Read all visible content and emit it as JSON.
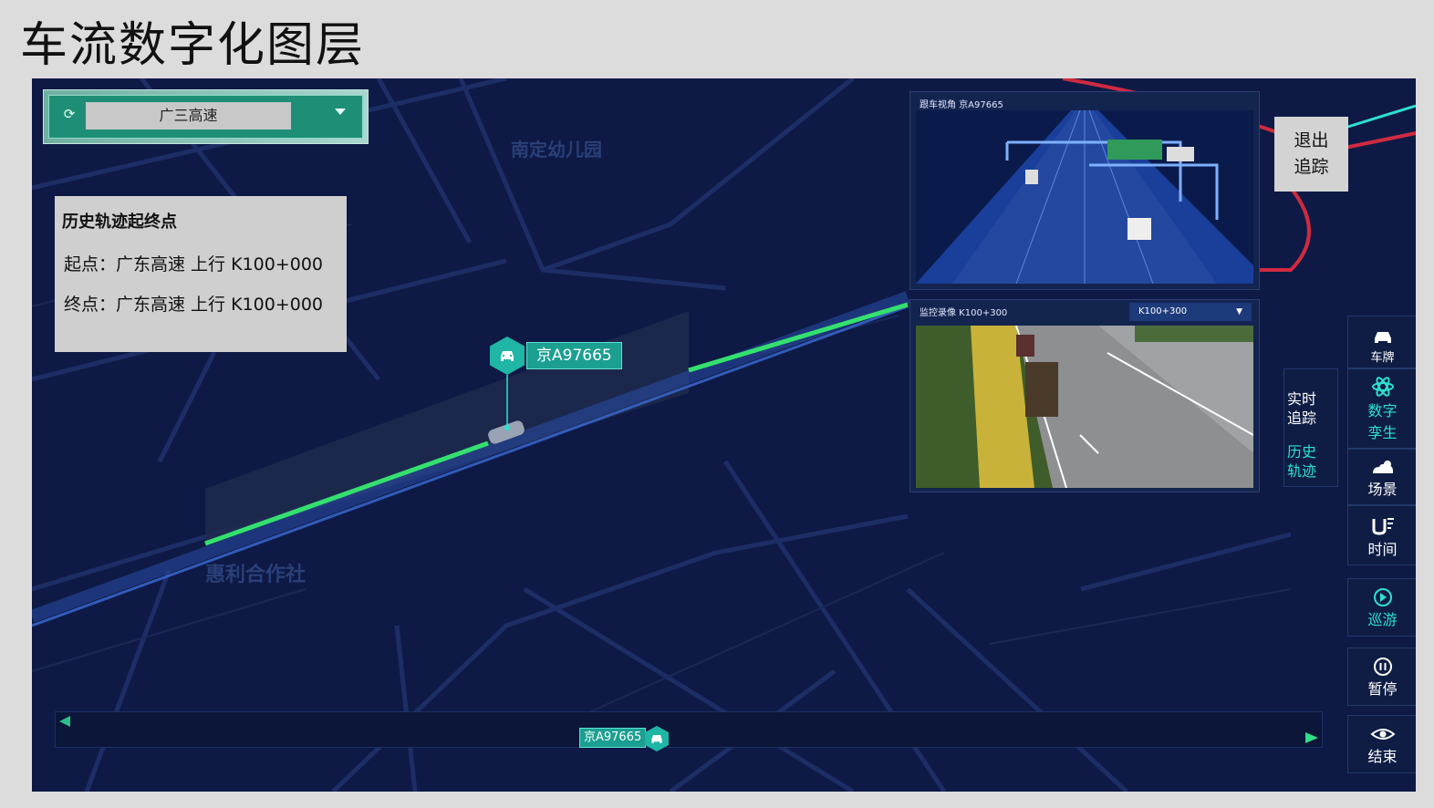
{
  "page": {
    "title": "车流数字化图层"
  },
  "road_selector": {
    "value": "广三高速"
  },
  "map_labels": {
    "kindergarten": "南定幼儿园",
    "cooperative": "惠利合作社"
  },
  "history": {
    "heading": "历史轨迹起终点",
    "start": "起点：广东高速  上行  K100+000",
    "end": "终点：广东高速  上行  K100+000"
  },
  "vehicle": {
    "plate": "京A97665"
  },
  "follow_view": {
    "caption": "跟车视角  京A97665"
  },
  "monitor": {
    "caption": "监控录像  K100+300",
    "selected": "K100+300"
  },
  "exit_tracking": {
    "line1": "退出",
    "line2": "追踪"
  },
  "sidebar": {
    "plate": "车牌",
    "digital_twin": [
      "数字",
      "孪生"
    ],
    "scene": "场景",
    "time": "时间",
    "cruise": "巡游",
    "pause": "暂停",
    "end": "结束"
  },
  "submenu": {
    "realtime": [
      "实时",
      "追踪"
    ],
    "history": [
      "历史",
      "轨迹"
    ]
  },
  "timeline": {
    "plate": "京A97665"
  },
  "colors": {
    "accent": "#2ee0d0",
    "map_bg": "#0e1a45",
    "track": "#2fe08a"
  }
}
